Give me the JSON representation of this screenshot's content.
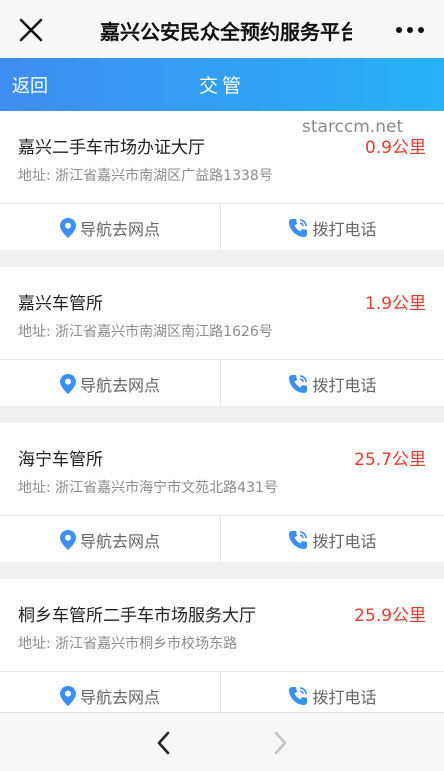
{
  "header": {
    "title": "嘉兴公安民众全预约服务平台"
  },
  "nav": {
    "back_label": "返回",
    "title": "交管"
  },
  "watermark": "starccm.net",
  "locations": [
    {
      "name": "嘉兴二手车市场办证大厅",
      "distance": "0.9公里",
      "address": "地址: 浙江省嘉兴市南湖区广益路1338号",
      "navigate_label": "导航去网点",
      "call_label": "拨打电话"
    },
    {
      "name": "嘉兴车管所",
      "distance": "1.9公里",
      "address": "地址: 浙江省嘉兴市南湖区南江路1626号",
      "navigate_label": "导航去网点",
      "call_label": "拨打电话"
    },
    {
      "name": "海宁车管所",
      "distance": "25.7公里",
      "address": "地址: 浙江省嘉兴市海宁市文苑北路431号",
      "navigate_label": "导航去网点",
      "call_label": "拨打电话"
    },
    {
      "name": "桐乡车管所二手车市场服务大厅",
      "distance": "25.9公里",
      "address": "地址: 浙江省嘉兴市桐乡市校场东路",
      "navigate_label": "导航去网点",
      "call_label": "拨打电话"
    }
  ],
  "colors": {
    "accent_start": "#3f8df0",
    "accent_end": "#27b2f5",
    "distance": "#e03c2f",
    "icon": "#3d8ef2"
  },
  "icons": {
    "close": "close-icon",
    "more": "more-icon",
    "location": "location-pin-icon",
    "phone": "phone-icon",
    "prev": "chevron-left-icon",
    "next": "chevron-right-icon"
  }
}
